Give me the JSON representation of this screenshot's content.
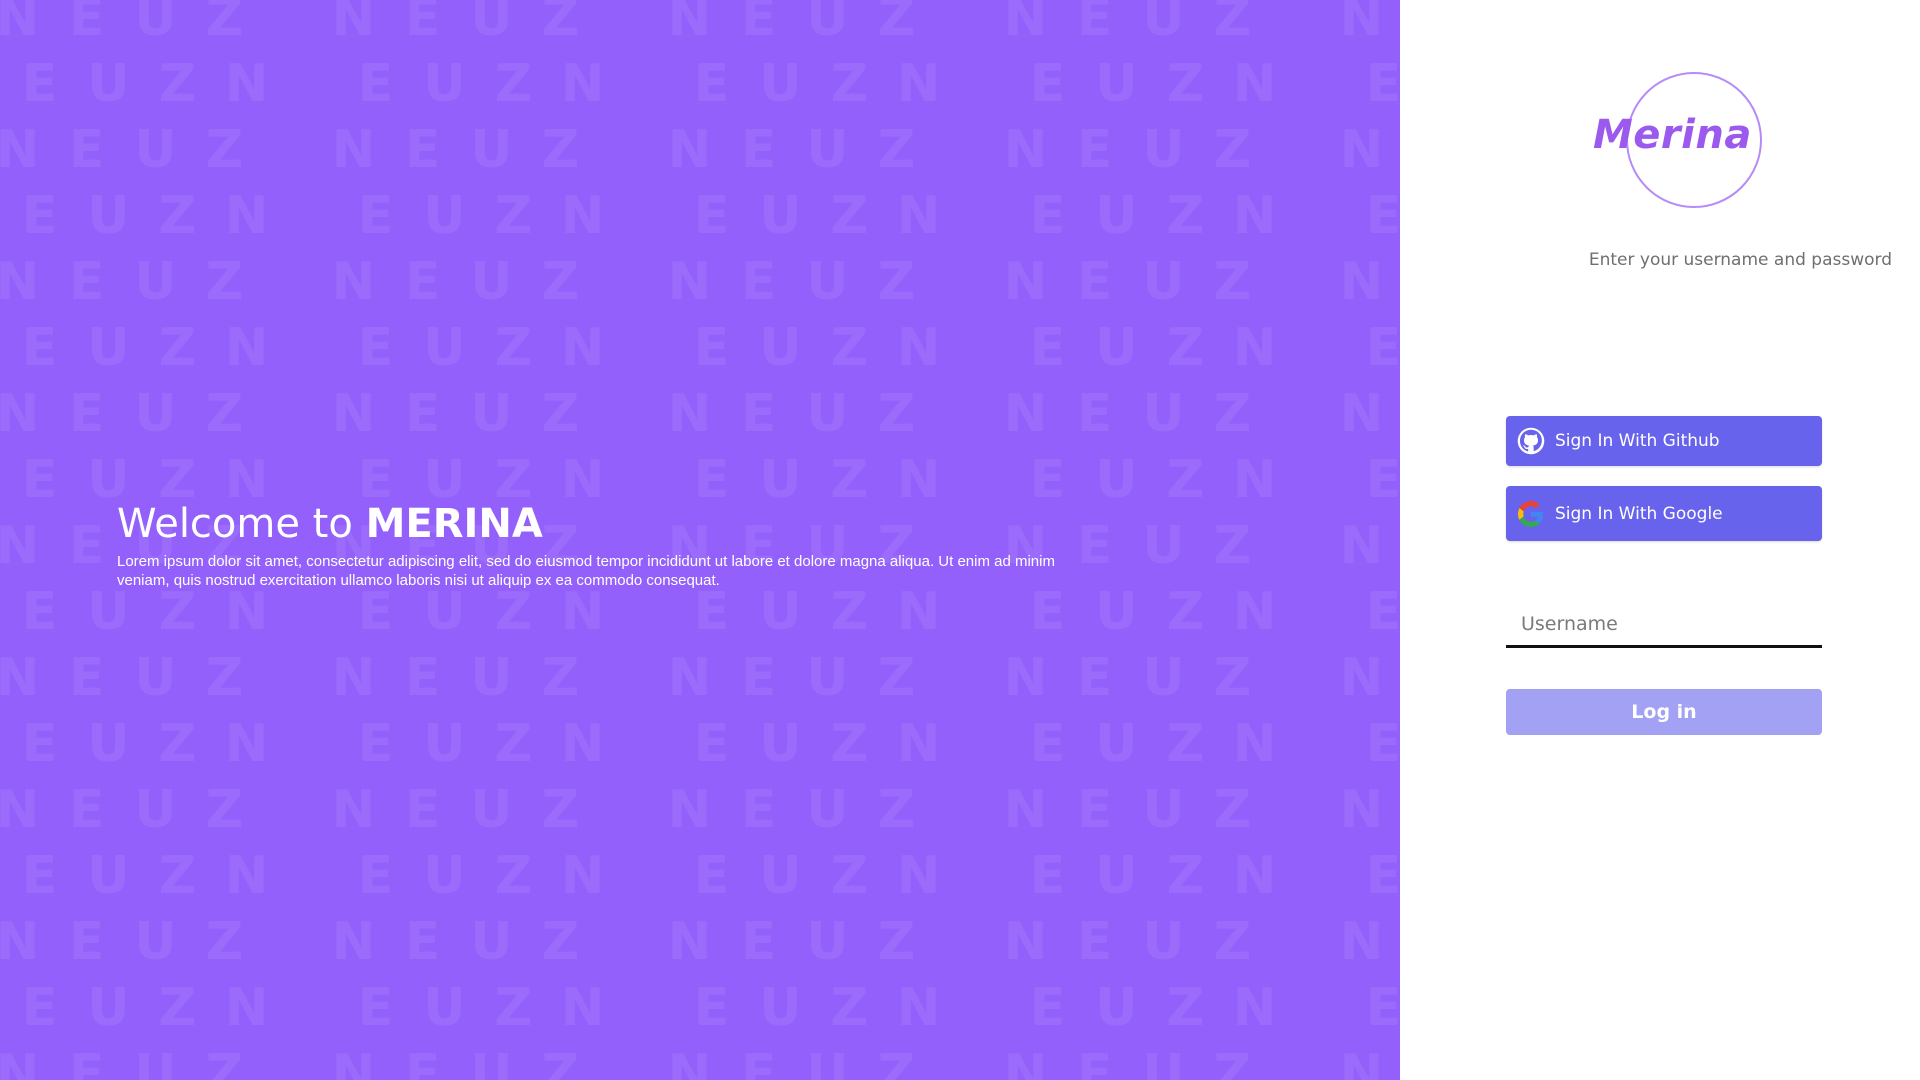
{
  "colors": {
    "hero_bg": "#9460fb",
    "accent": "#6763ec",
    "login_disabled": "#a2a1f3",
    "logo": "#9b59ee"
  },
  "hero": {
    "pattern_letters": [
      "N",
      "E",
      "U",
      "Z"
    ],
    "welcome_prefix": "Welcome to ",
    "welcome_brand": "MERINA",
    "description": "Lorem ipsum dolor sit amet, consectetur adipiscing elit, sed do eiusmod tempor incididunt ut labore et dolore magna aliqua. Ut enim ad minim veniam, quis nostrud exercitation ullamco laboris nisi ut aliquip ex ea commodo consequat."
  },
  "panel": {
    "logo_text": "Merina",
    "instruction": "Enter your username and password",
    "github_button": {
      "label": "Sign In With Github",
      "icon": "github-icon"
    },
    "google_button": {
      "label": "Sign In With Google",
      "icon": "google-icon"
    },
    "username": {
      "placeholder": "Username",
      "value": ""
    },
    "login_button": "Log in"
  }
}
